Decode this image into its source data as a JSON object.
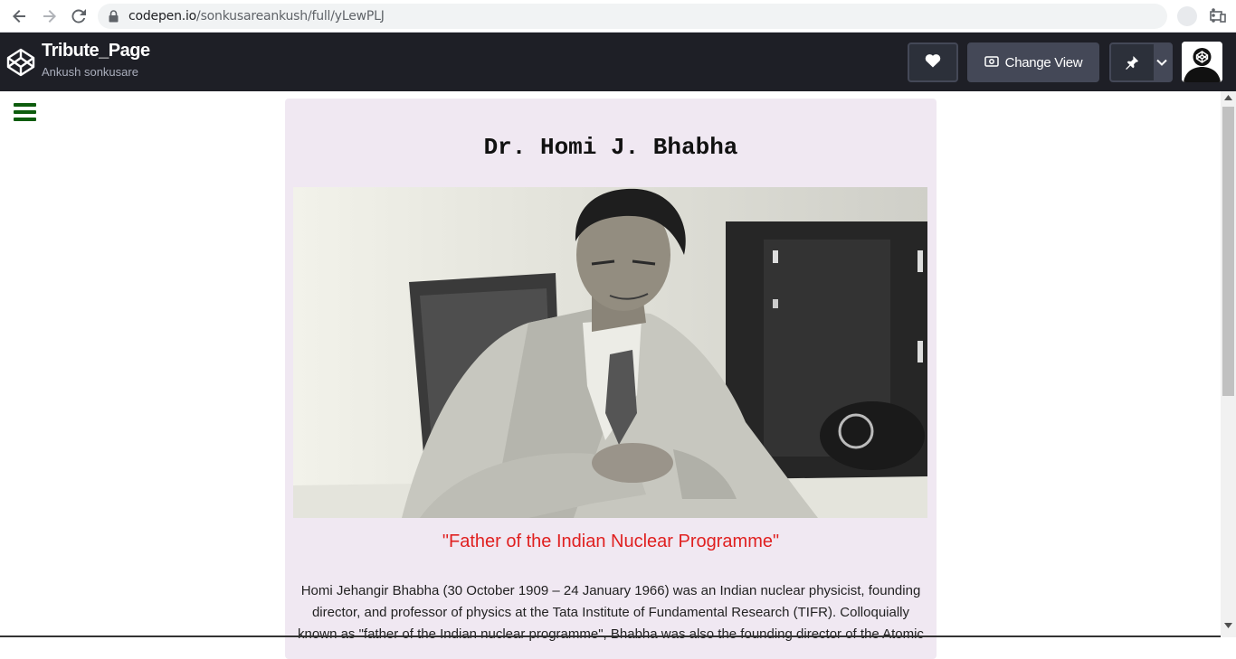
{
  "browser": {
    "url_host": "codepen.io",
    "url_path": "/sonkusareankush/full/yLewPLJ"
  },
  "codepen": {
    "title": "Tribute_Page",
    "author": "Ankush sonkusare",
    "change_view_label": "Change View"
  },
  "page": {
    "heading": "Dr. Homi J. Bhabha",
    "tagline": "\"Father of the Indian Nuclear Programme\"",
    "bio": "Homi Jehangir Bhabha (30 October 1909 – 24 January 1966) was an Indian nuclear physicist, founding director, and professor of physics at the Tata Institute of Fundamental Research (TIFR). Colloquially known as \"father of the Indian nuclear programme\", Bhabha was also the founding director of the Atomic"
  },
  "colors": {
    "codepen_header": "#1e1f26",
    "card_background": "#f0e8f2",
    "tagline": "#e02020",
    "hamburger": "#0d5c0d"
  },
  "icons": [
    "back-icon",
    "forward-icon",
    "reload-icon",
    "lock-icon",
    "cast-icon",
    "star-icon",
    "menu-kebab-icon",
    "codepen-logo-icon",
    "heart-icon",
    "eye-icon",
    "pin-icon",
    "chevron-down-icon",
    "hamburger-icon"
  ]
}
